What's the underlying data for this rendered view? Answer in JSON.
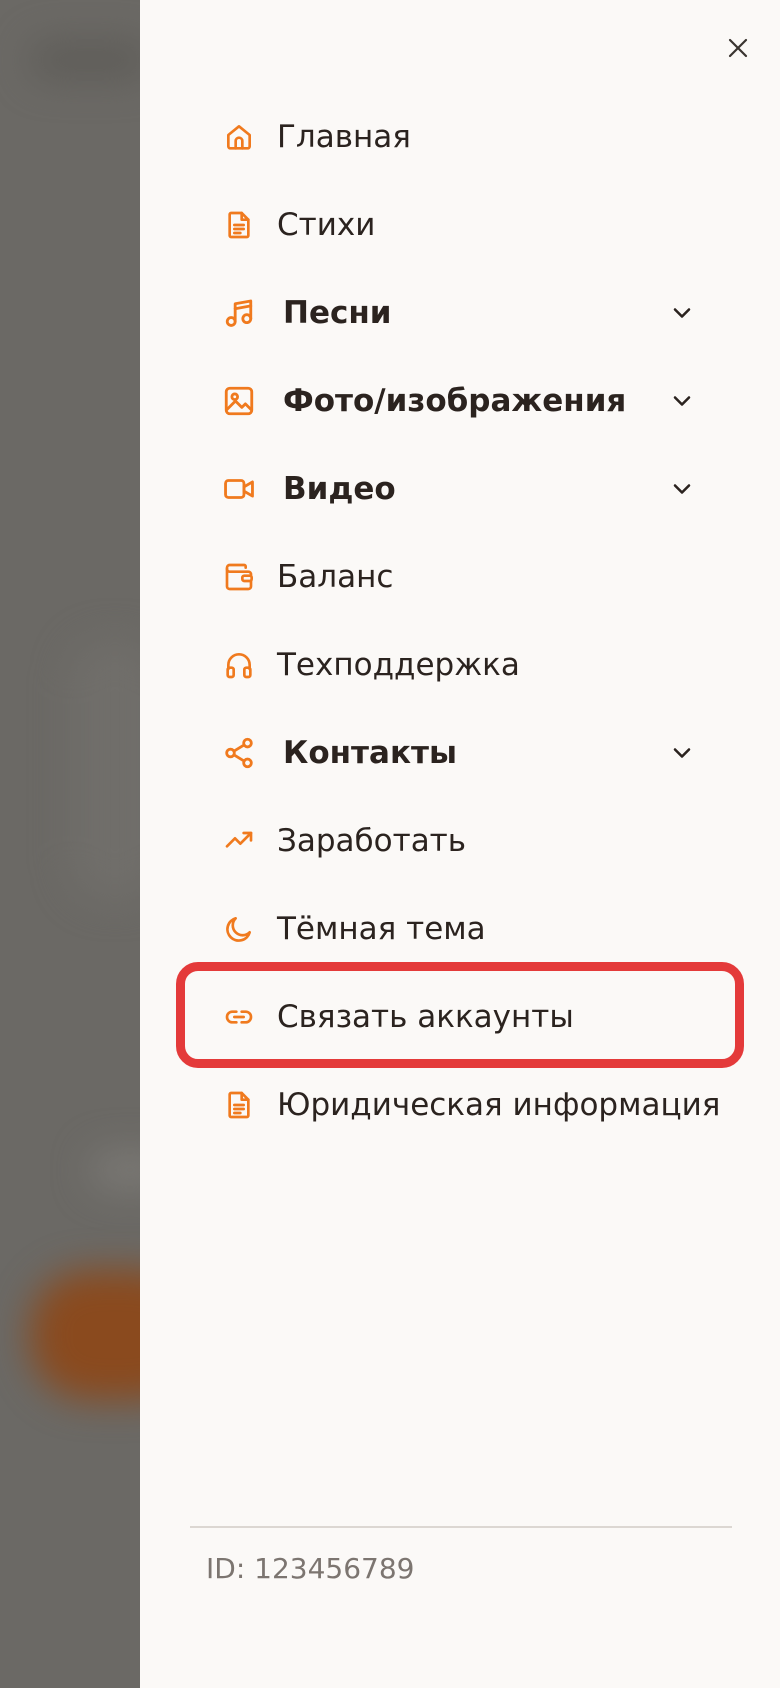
{
  "colors": {
    "accent": "#f07a1e",
    "text": "#2b231f",
    "muted": "#7c7570",
    "highlight_border": "#e43a3a",
    "overlay": "#6b6965",
    "drawer_bg": "#fbf9f7"
  },
  "drawer": {
    "close_icon": "close-icon",
    "items": [
      {
        "label": "Главная",
        "icon": "home-icon",
        "expandable": false
      },
      {
        "label": "Стихи",
        "icon": "document-icon",
        "expandable": false
      },
      {
        "label": "Песни",
        "icon": "music-note-icon",
        "expandable": true
      },
      {
        "label": "Фото/изображения",
        "icon": "image-icon",
        "expandable": true
      },
      {
        "label": "Видео",
        "icon": "video-camera-icon",
        "expandable": true
      },
      {
        "label": "Баланс",
        "icon": "wallet-icon",
        "expandable": false
      },
      {
        "label": "Техподдержка",
        "icon": "headphones-icon",
        "expandable": false
      },
      {
        "label": "Контакты",
        "icon": "share-icon",
        "expandable": true
      },
      {
        "label": "Заработать",
        "icon": "trending-up-icon",
        "expandable": false
      },
      {
        "label": "Тёмная тема",
        "icon": "moon-icon",
        "expandable": false
      },
      {
        "label": "Связать аккаунты",
        "icon": "link-icon",
        "expandable": false,
        "highlighted": true
      },
      {
        "label": "Юридическая информация",
        "icon": "document-icon",
        "expandable": false
      }
    ],
    "footer": {
      "user_id": "ID: 123456789"
    }
  }
}
